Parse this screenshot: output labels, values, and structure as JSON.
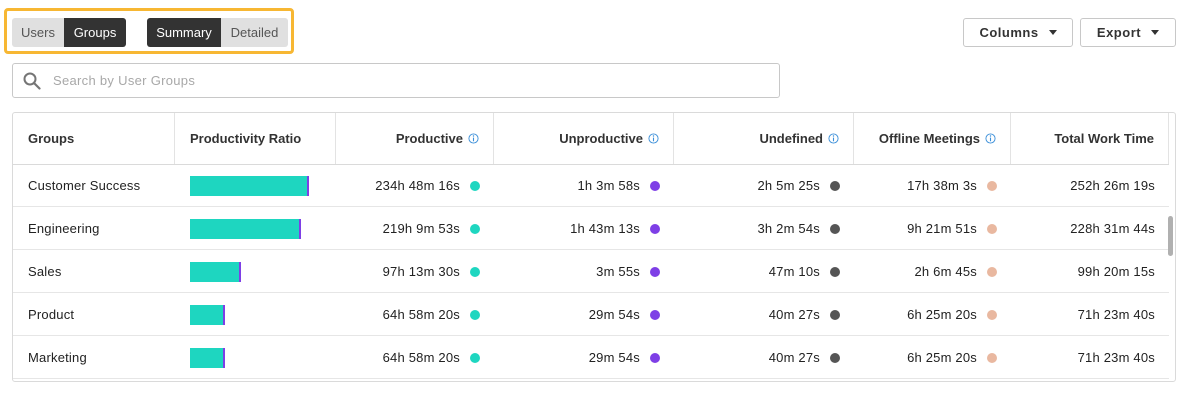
{
  "view_toggle": {
    "users": "Users",
    "groups": "Groups",
    "active": "Groups"
  },
  "mode_toggle": {
    "summary": "Summary",
    "detailed": "Detailed",
    "active": "Summary"
  },
  "toolbar": {
    "columns": "Columns",
    "export": "Export"
  },
  "search": {
    "placeholder": "Search by User Groups",
    "value": ""
  },
  "colors": {
    "productive": "#1ed6c0",
    "unproductive": "#7e3fe6",
    "undefined": "#555555",
    "offline": "#e9b8a0",
    "highlight": "#f7b733",
    "info": "#3b8fd9"
  },
  "table": {
    "headers": {
      "groups": "Groups",
      "ratio": "Productivity Ratio",
      "productive": "Productive",
      "unproductive": "Unproductive",
      "undefined": "Undefined",
      "offline": "Offline Meetings",
      "total": "Total Work Time"
    },
    "rows": [
      {
        "group": "Customer Success",
        "ratio_productive": 0.93,
        "productive": "234h 48m 16s",
        "unproductive": "1h 3m 58s",
        "undefined": "2h 5m 25s",
        "offline": "17h 38m 3s",
        "total": "252h 26m 19s"
      },
      {
        "group": "Engineering",
        "ratio_productive": 0.96,
        "productive": "219h 9m 53s",
        "unproductive": "1h 43m 13s",
        "undefined": "3h 2m 54s",
        "offline": "9h 21m 51s",
        "total": "228h 31m 44s"
      },
      {
        "group": "Sales",
        "ratio_productive": 0.97,
        "productive": "97h 13m 30s",
        "unproductive": "3m 55s",
        "undefined": "47m 10s",
        "offline": "2h 6m 45s",
        "total": "99h 20m 15s"
      },
      {
        "group": "Product",
        "ratio_productive": 0.91,
        "productive": "64h 58m 20s",
        "unproductive": "29m 54s",
        "undefined": "40m 27s",
        "offline": "6h 25m 20s",
        "total": "71h 23m 40s"
      },
      {
        "group": "Marketing",
        "ratio_productive": 0.91,
        "productive": "64h 58m 20s",
        "unproductive": "29m 54s",
        "undefined": "40m 27s",
        "offline": "6h 25m 20s",
        "total": "71h 23m 40s"
      }
    ]
  }
}
